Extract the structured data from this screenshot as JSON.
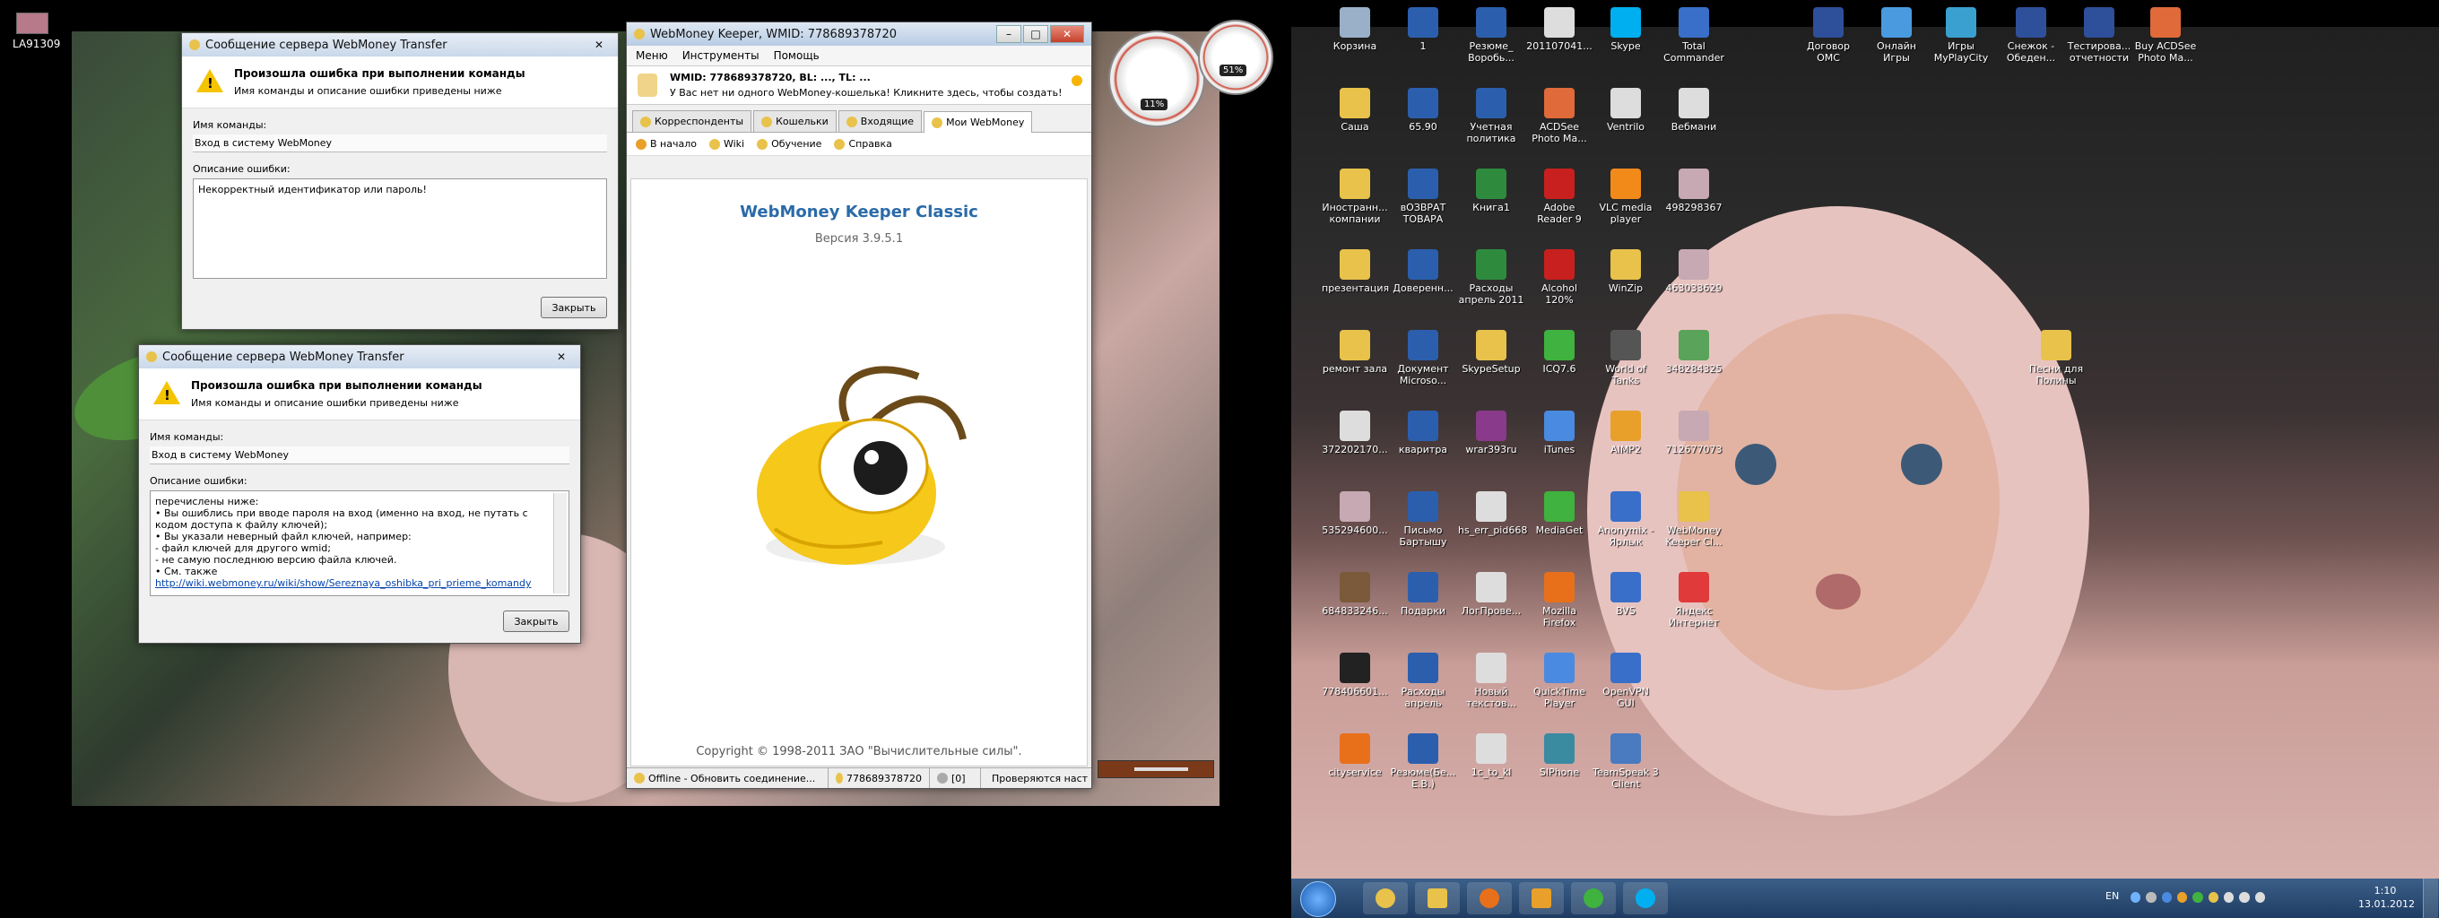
{
  "top_left": {
    "label": "LA91309"
  },
  "error_dialog_1": {
    "title": "Сообщение сервера WebMoney Transfer",
    "heading": "Произошла ошибка при выполнении команды",
    "subheading": "Имя команды и описание ошибки приведены ниже",
    "command_label": "Имя команды:",
    "command_value": "Вход в систему WebMoney",
    "desc_label": "Описание ошибки:",
    "desc_value": "Некорректный идентификатор или пароль!",
    "close_button": "Закрыть",
    "close_x": "✕"
  },
  "error_dialog_2": {
    "title": "Сообщение сервера WebMoney Transfer",
    "heading": "Произошла ошибка при выполнении команды",
    "subheading": "Имя команды и описание ошибки приведены ниже",
    "command_label": "Имя команды:",
    "command_value": "Вход в систему WebMoney",
    "desc_label": "Описание ошибки:",
    "desc_lines": [
      "перечислены ниже:",
      "• Вы ошиблись при вводе пароля на вход (именно на вход, не путать с",
      "кодом доступа к файлу ключей);",
      "• Вы указали неверный файл ключей, например:",
      "   - файл ключей для другого wmid;",
      "   - не самую последнюю версию файла ключей.",
      "• См. также"
    ],
    "desc_link": "http://wiki.webmoney.ru/wiki/show/Sereznaya_oshibka_pri_prieme_komandy",
    "close_button": "Закрыть",
    "close_x": "✕"
  },
  "keeper": {
    "title": "WebMoney Keeper, WMID: 778689378720",
    "menu": [
      "Меню",
      "Инструменты",
      "Помощь"
    ],
    "notice_title": "WMID: 778689378720, BL: ..., TL: ...",
    "notice_text": "У Вас нет ни одного WebMoney-кошелька! Кликните здесь, чтобы создать!",
    "tabs": [
      "Корреспонденты",
      "Кошельки",
      "Входящие",
      "Мои WebMoney"
    ],
    "toolbar": [
      "В начало",
      "Wiki",
      "Обучение",
      "Справка"
    ],
    "product_name": "WebMoney Keeper Classic",
    "version": "Версия 3.9.5.1",
    "copyright": "Copyright © 1998-2011 ЗАО \"Вычислительные силы\".",
    "status": [
      "Offline - Обновить соединение...",
      "778689378720",
      "[0]",
      "Проверяются наст"
    ]
  },
  "gauge": {
    "cpu": "11%",
    "mem": "51%"
  },
  "desktop_icons": [
    {
      "label": "Корзина",
      "color": "#9ab0c8"
    },
    {
      "label": "1",
      "color": "#2b5fae"
    },
    {
      "label": "Резюме_ Воробь...",
      "color": "#2b5fae"
    },
    {
      "label": "201107041...",
      "color": "#dddddd"
    },
    {
      "label": "Skype",
      "color": "#00aff0"
    },
    {
      "label": "Total Commander",
      "color": "#3a6fc9"
    },
    {
      "label": "Договор ОМС",
      "color": "#2e4f9a"
    },
    {
      "label": "Онлайн Игры",
      "color": "#4a9ae0"
    },
    {
      "label": "Игры MyPlayCity",
      "color": "#3aa0d0"
    },
    {
      "label": "Снежок - Обеден...",
      "color": "#2e4f9a"
    },
    {
      "label": "Тестирова... отчетности",
      "color": "#2e4f9a"
    },
    {
      "label": "Buy ACDSee Photo Ma...",
      "color": "#e06a3a"
    },
    {
      "label": "Саша",
      "color": "#e8c24a"
    },
    {
      "label": "65.90",
      "color": "#2b5fae"
    },
    {
      "label": "Учетная политика",
      "color": "#2b5fae"
    },
    {
      "label": "ACDSee Photo Ma...",
      "color": "#e06a3a"
    },
    {
      "label": "Ventrilo",
      "color": "#dddddd"
    },
    {
      "label": "Вебмани",
      "color": "#dddddd"
    },
    {
      "label": "Иностранн... компании",
      "color": "#e8c24a"
    },
    {
      "label": "вОЗВРАТ ТОВАРА",
      "color": "#2b5fae"
    },
    {
      "label": "Книга1",
      "color": "#2e8b3e"
    },
    {
      "label": "Adobe Reader 9",
      "color": "#c8201e"
    },
    {
      "label": "VLC media player",
      "color": "#f28a1a"
    },
    {
      "label": "498298367",
      "color": "#c7a9b3"
    },
    {
      "label": "презентация",
      "color": "#e8c24a"
    },
    {
      "label": "Доверенн...",
      "color": "#2b5fae"
    },
    {
      "label": "Расходы апрель 2011",
      "color": "#2e8b3e"
    },
    {
      "label": "Alcohol 120%",
      "color": "#c8201e"
    },
    {
      "label": "WinZip",
      "color": "#e8c24a"
    },
    {
      "label": "463033629",
      "color": "#c7a9b3"
    },
    {
      "label": "ремонт зала",
      "color": "#e8c24a"
    },
    {
      "label": "Документ Microso...",
      "color": "#2b5fae"
    },
    {
      "label": "SkypeSetup",
      "color": "#e8c24a"
    },
    {
      "label": "ICQ7.6",
      "color": "#3fb23f"
    },
    {
      "label": "World of Tanks",
      "color": "#555555"
    },
    {
      "label": "348284325",
      "color": "#5aa35a"
    },
    {
      "label": "Песни для Полины",
      "color": "#e8c24a"
    },
    {
      "label": "372202170...",
      "color": "#dddddd"
    },
    {
      "label": "кваритра",
      "color": "#2b5fae"
    },
    {
      "label": "wrar393ru",
      "color": "#8a3a8a"
    },
    {
      "label": "iTunes",
      "color": "#4a8ae0"
    },
    {
      "label": "AIMP2",
      "color": "#e8a02a"
    },
    {
      "label": "712677073",
      "color": "#c7a9b3"
    },
    {
      "label": "535294600...",
      "color": "#c7a9b3"
    },
    {
      "label": "Письмо Бартышу",
      "color": "#2b5fae"
    },
    {
      "label": "hs_err_pid668",
      "color": "#dddddd"
    },
    {
      "label": "MediaGet",
      "color": "#3fb23f"
    },
    {
      "label": "Anonymix - Ярлык",
      "color": "#3a6fc9"
    },
    {
      "label": "WebMoney Keeper Cl...",
      "color": "#e8c24a"
    },
    {
      "label": "684833246...",
      "color": "#7a5a3a"
    },
    {
      "label": "Подарки",
      "color": "#2b5fae"
    },
    {
      "label": "ЛогПрове...",
      "color": "#dddddd"
    },
    {
      "label": "Mozilla Firefox",
      "color": "#e8701a"
    },
    {
      "label": "BVS",
      "color": "#3a6fc9"
    },
    {
      "label": "Яндекс Интернет",
      "color": "#e03a3a"
    },
    {
      "label": "778406601...",
      "color": "#222222"
    },
    {
      "label": "Расходы апрель",
      "color": "#2b5fae"
    },
    {
      "label": "Новый текстов...",
      "color": "#dddddd"
    },
    {
      "label": "QuickTime Player",
      "color": "#4a8ae0"
    },
    {
      "label": "OpenVPN GUI",
      "color": "#3a6fc9"
    },
    {
      "label": "cityservice",
      "color": "#e8701a"
    },
    {
      "label": "Резюме(Бе... Е.В.)",
      "color": "#2b5fae"
    },
    {
      "label": "1c_to_kl",
      "color": "#dddddd"
    },
    {
      "label": "SIPhone",
      "color": "#3a8aa0"
    },
    {
      "label": "TeamSpeak 3 Client",
      "color": "#4a7ac0"
    }
  ],
  "taskbar": {
    "lang": "EN",
    "time": "1:10",
    "date": "13.01.2012"
  }
}
